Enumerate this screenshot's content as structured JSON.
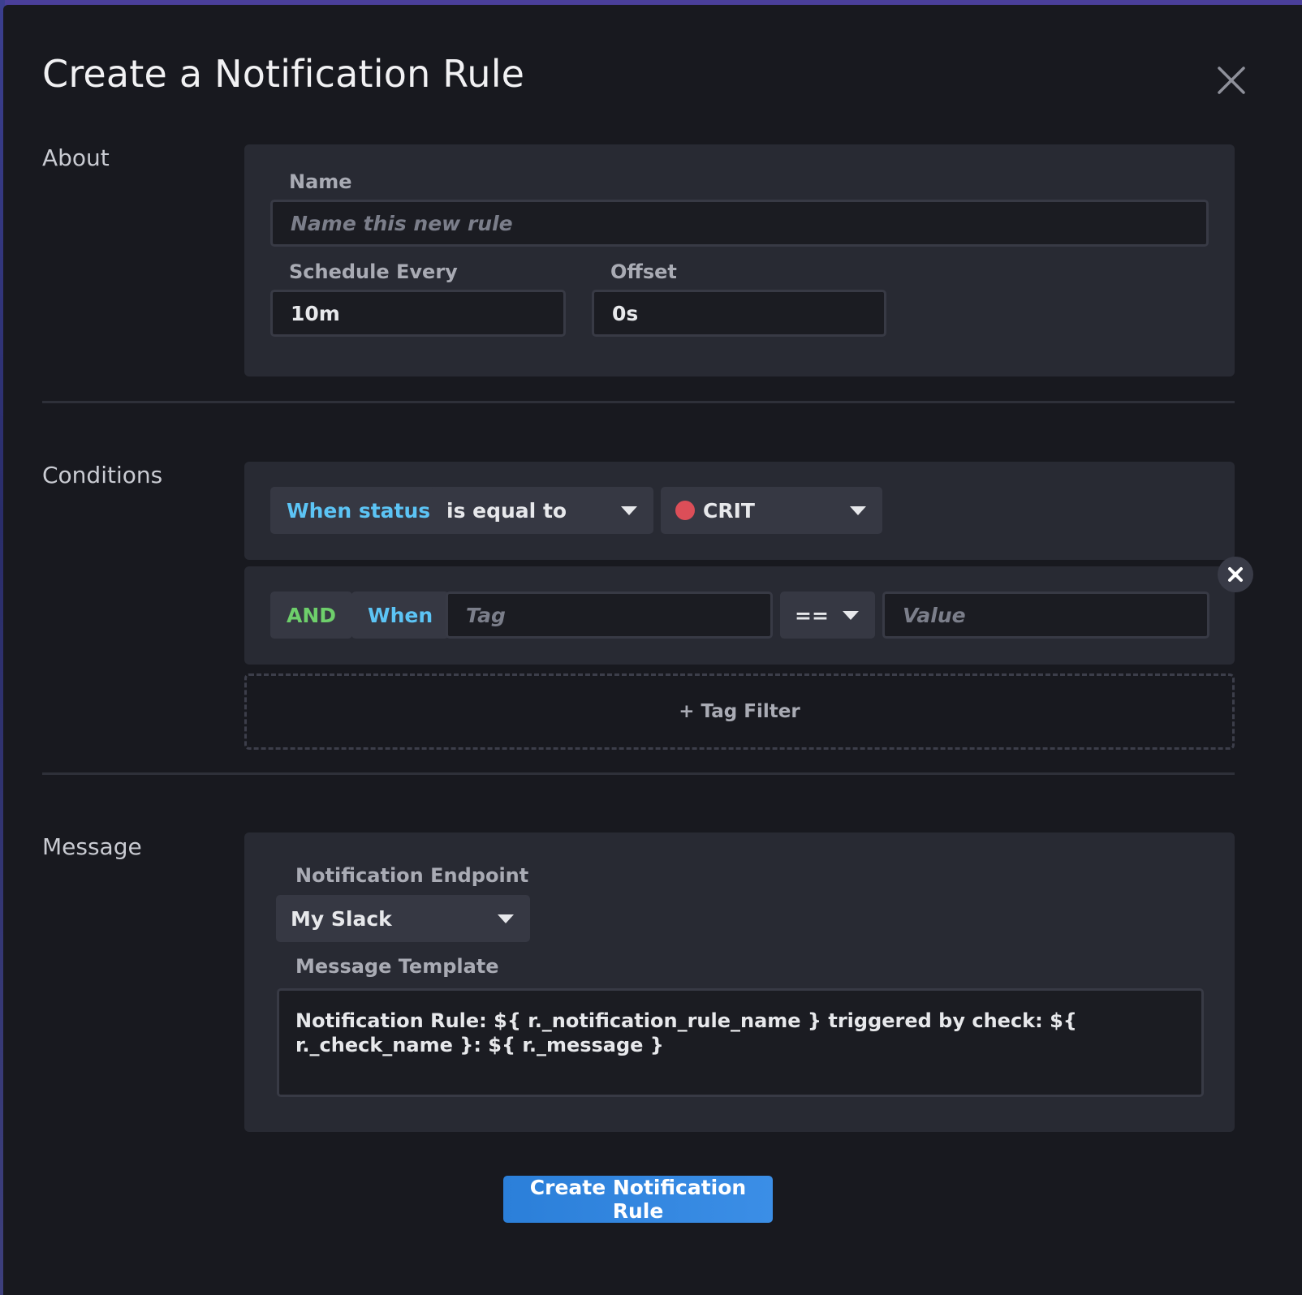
{
  "dialog": {
    "title": "Create a Notification Rule"
  },
  "about": {
    "section_label": "About",
    "name_label": "Name",
    "name_placeholder": "Name this new rule",
    "schedule_label": "Schedule Every",
    "schedule_value": "10m",
    "offset_label": "Offset",
    "offset_value": "0s"
  },
  "conditions": {
    "section_label": "Conditions",
    "status_chip": "When status",
    "comparator": "is equal to",
    "status_value": "CRIT",
    "status_color": "#dc4e58",
    "tag_row": {
      "and_chip": "AND",
      "when_chip": "When",
      "tag_placeholder": "Tag",
      "operator": "==",
      "value_placeholder": "Value"
    },
    "add_tag_filter": "+ Tag Filter"
  },
  "message": {
    "section_label": "Message",
    "endpoint_label": "Notification Endpoint",
    "endpoint_value": "My Slack",
    "template_label": "Message Template",
    "template_value": "Notification Rule: ${ r._notification_rule_name } triggered by check: ${ r._check_name }: ${ r._message }"
  },
  "actions": {
    "submit_label": "Create Notification Rule"
  },
  "colors": {
    "accent_blue": "#2b7fd9",
    "chip_blue": "#5cc4f5",
    "chip_green": "#6ecf6b",
    "background": "#18191f",
    "panel": "#282a33"
  }
}
